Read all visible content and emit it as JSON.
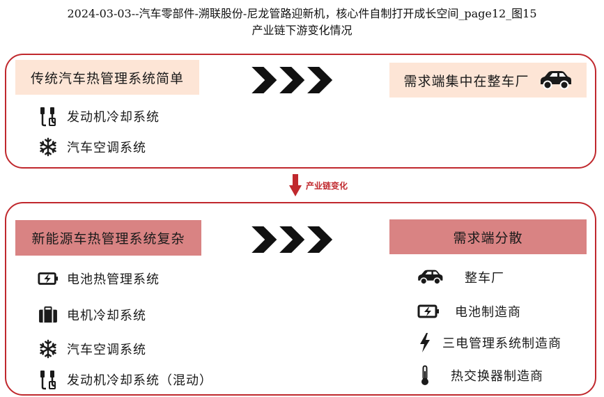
{
  "header": {
    "title_line1": "2024-03-03--汽车零部件-溯联股份-尼龙管路迎新机，核心件自制打开成长空间_page12_图15",
    "title_line2": "产业链下游变化情况"
  },
  "top": {
    "left_tag": "传统汽车热管理系统简单",
    "right_tag": "需求端集中在整车厂",
    "right_icon": "car-icon",
    "items": [
      {
        "label": "发动机冷却系统",
        "icon": "coolant-hose-icon"
      },
      {
        "label": "汽车空调系统",
        "icon": "snowflake-icon"
      }
    ]
  },
  "middle": {
    "label": "产业链变化",
    "icon": "down-arrow-icon"
  },
  "bottom": {
    "left_tag": "新能源车热管理系统复杂",
    "right_tag": "需求端分散",
    "left_items": [
      {
        "label": "电池热管理系统",
        "icon": "battery-icon"
      },
      {
        "label": "电机冷却系统",
        "icon": "motor-case-icon"
      },
      {
        "label": "汽车空调系统",
        "icon": "snowflake-icon"
      },
      {
        "label": "发动机冷却系统（混动）",
        "icon": "coolant-hose-icon"
      }
    ],
    "right_items": [
      {
        "label": "整车厂",
        "icon": "car-icon"
      },
      {
        "label": "电池制造商",
        "icon": "battery-icon"
      },
      {
        "label": "三电管理系统制造商",
        "icon": "lightning-icon"
      },
      {
        "label": "热交换器制造商",
        "icon": "thermometer-icon"
      }
    ]
  },
  "colors": {
    "accent": "#c0282d",
    "tag_light": "#fde5d6",
    "tag_dark": "#d98383"
  }
}
